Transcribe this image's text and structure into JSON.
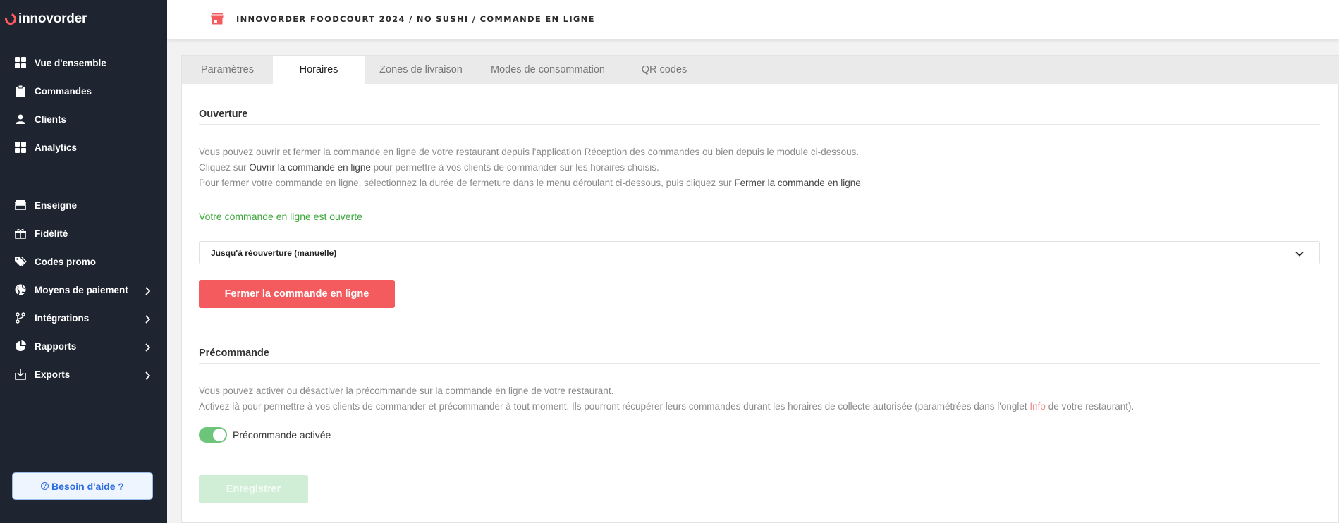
{
  "brand": {
    "name": "innovorder",
    "accent": "#ff5a5f"
  },
  "sidebar": {
    "items": [
      {
        "label": "Vue d'ensemble",
        "icon": "grid-icon"
      },
      {
        "label": "Commandes",
        "icon": "clipboard-icon"
      },
      {
        "label": "Clients",
        "icon": "user-icon"
      },
      {
        "label": "Analytics",
        "icon": "grid-icon"
      },
      {
        "label": "Enseigne",
        "icon": "store-icon"
      },
      {
        "label": "Fidélité",
        "icon": "gift-icon"
      },
      {
        "label": "Codes promo",
        "icon": "tag-icon"
      },
      {
        "label": "Moyens de paiement",
        "icon": "globe-icon"
      },
      {
        "label": "Intégrations",
        "icon": "branch-icon"
      },
      {
        "label": "Rapports",
        "icon": "pie-icon"
      },
      {
        "label": "Exports",
        "icon": "download-icon"
      }
    ],
    "help_label": "Besoin d'aide ?"
  },
  "header": {
    "breadcrumb": "INNOVORDER FOODCOURT 2024 / NO SUSHI / COMMANDE EN LIGNE"
  },
  "tabs": [
    {
      "label": "Paramètres"
    },
    {
      "label": "Horaires",
      "active": true
    },
    {
      "label": "Zones de livraison"
    },
    {
      "label": "Modes de consommation"
    },
    {
      "label": "QR codes"
    }
  ],
  "ouverture": {
    "title": "Ouverture",
    "line1": "Vous pouvez ouvrir et fermer la commande en ligne de votre restaurant depuis l'application Réception des commandes ou bien depuis le module ci-dessous.",
    "line2_prefix": "Cliquez sur ",
    "line2_bold": "Ouvrir la commande en ligne",
    "line2_suffix": " pour permettre à vos clients de commander sur les horaires choisis.",
    "line3_prefix": "Pour fermer votre commande en ligne, sélectionnez la durée de fermeture dans le menu déroulant ci-dessous, puis cliquez sur ",
    "line3_bold": "Fermer la commande en ligne",
    "status": "Votre commande en ligne est ouverte",
    "select_value": "Jusqu'à réouverture (manuelle)",
    "close_button": "Fermer la commande en ligne"
  },
  "precommande": {
    "title": "Précommande",
    "line1": "Vous pouvez activer ou désactiver la précommande sur la commande en ligne de votre restaurant.",
    "line2_prefix": "Activez là pour permettre à vos clients de commander et précommander à tout moment. Ils pourront récupérer leurs commandes durant les horaires de collecte autorisée (paramétrées dans l'onglet ",
    "line2_link": "Info",
    "line2_suffix": " de votre restaurant).",
    "toggle_label": "Précommande activée",
    "toggle_on": true
  },
  "save_button": "Enregistrer",
  "colors": {
    "sidebar_bg": "#1e2530",
    "danger": "#f45b5e",
    "success_text": "#3aa63a",
    "toggle_on": "#6dc57a",
    "save_disabled": "#cfeed5",
    "link_pink": "#f08a8a"
  }
}
